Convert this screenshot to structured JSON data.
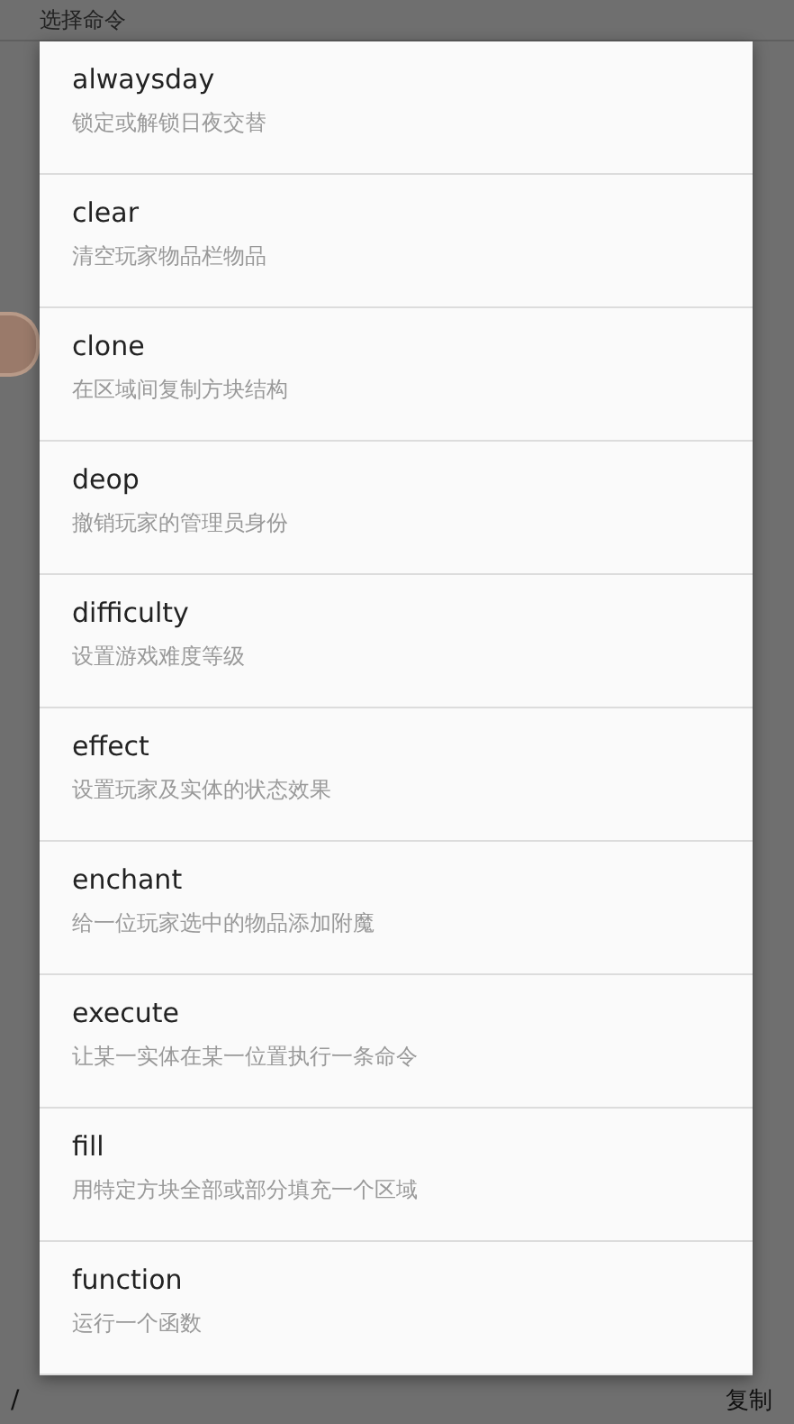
{
  "page": {
    "title": "选择命令",
    "input_prefix": "/",
    "copy_button": "复制"
  },
  "dialog": {
    "items": [
      {
        "name": "alwaysday",
        "description": "锁定或解锁日夜交替"
      },
      {
        "name": "clear",
        "description": "清空玩家物品栏物品"
      },
      {
        "name": "clone",
        "description": "在区域间复制方块结构"
      },
      {
        "name": "deop",
        "description": "撤销玩家的管理员身份"
      },
      {
        "name": "difficulty",
        "description": "设置游戏难度等级"
      },
      {
        "name": "effect",
        "description": "设置玩家及实体的状态效果"
      },
      {
        "name": "enchant",
        "description": "给一位玩家选中的物品添加附魔"
      },
      {
        "name": "execute",
        "description": "让某一实体在某一位置执行一条命令"
      },
      {
        "name": "fill",
        "description": "用特定方块全部或部分填充一个区域"
      },
      {
        "name": "function",
        "description": "运行一个函数"
      }
    ]
  }
}
